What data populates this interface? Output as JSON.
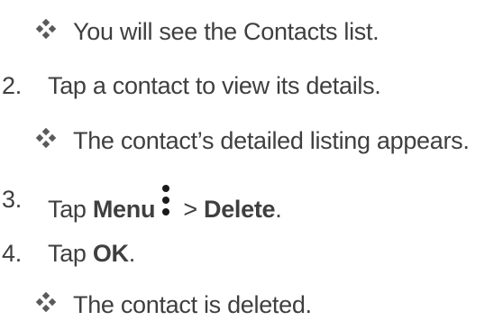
{
  "lines": [
    {
      "type": "bullet",
      "text": "You will see the Contacts list."
    },
    {
      "type": "step",
      "number": "2.",
      "text": "Tap a contact to view its details."
    },
    {
      "type": "bullet",
      "text": "The contact’s detailed listing appears."
    },
    {
      "type": "step",
      "number": "3.",
      "parts": {
        "a": "Tap ",
        "b": "Menu",
        "c": " > ",
        "d": "Delete",
        "e": "."
      }
    },
    {
      "type": "step",
      "number": "4.",
      "parts": {
        "a": "Tap ",
        "b": "OK",
        "c": "."
      }
    },
    {
      "type": "bullet",
      "text": "The contact is deleted."
    }
  ],
  "icons": {
    "bullet": "diamond-bullet-icon",
    "menu": "three-dot-menu-icon"
  },
  "colors": {
    "text": "#3f3f3f",
    "bullet": "#5a5a5a"
  }
}
